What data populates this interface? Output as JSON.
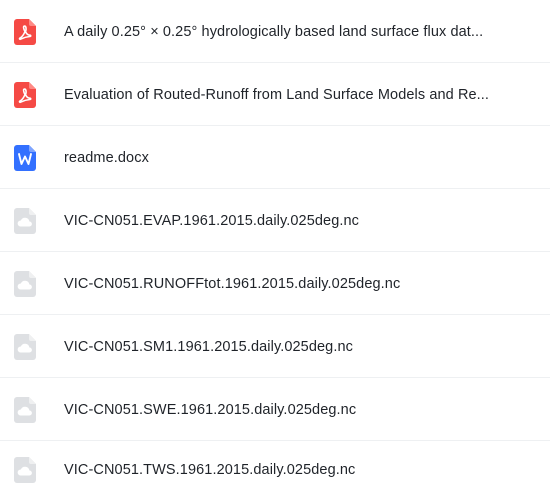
{
  "files": [
    {
      "name": "A daily 0.25° × 0.25° hydrologically based land surface flux dat...",
      "icon": "pdf-icon",
      "color": "#f54a45"
    },
    {
      "name": "Evaluation of Routed-Runoff from Land Surface Models and Re...",
      "icon": "pdf-icon",
      "color": "#f54a45"
    },
    {
      "name": "readme.docx",
      "icon": "word-icon",
      "color": "#3370ff"
    },
    {
      "name": "VIC-CN051.EVAP.1961.2015.daily.025deg.nc",
      "icon": "cloud-file-icon",
      "color": "#dee0e3"
    },
    {
      "name": "VIC-CN051.RUNOFFtot.1961.2015.daily.025deg.nc",
      "icon": "cloud-file-icon",
      "color": "#dee0e3"
    },
    {
      "name": "VIC-CN051.SM1.1961.2015.daily.025deg.nc",
      "icon": "cloud-file-icon",
      "color": "#dee0e3"
    },
    {
      "name": "VIC-CN051.SWE.1961.2015.daily.025deg.nc",
      "icon": "cloud-file-icon",
      "color": "#dee0e3"
    },
    {
      "name": "VIC-CN051.TWS.1961.2015.daily.025deg.nc",
      "icon": "cloud-file-icon",
      "color": "#dee0e3"
    }
  ]
}
